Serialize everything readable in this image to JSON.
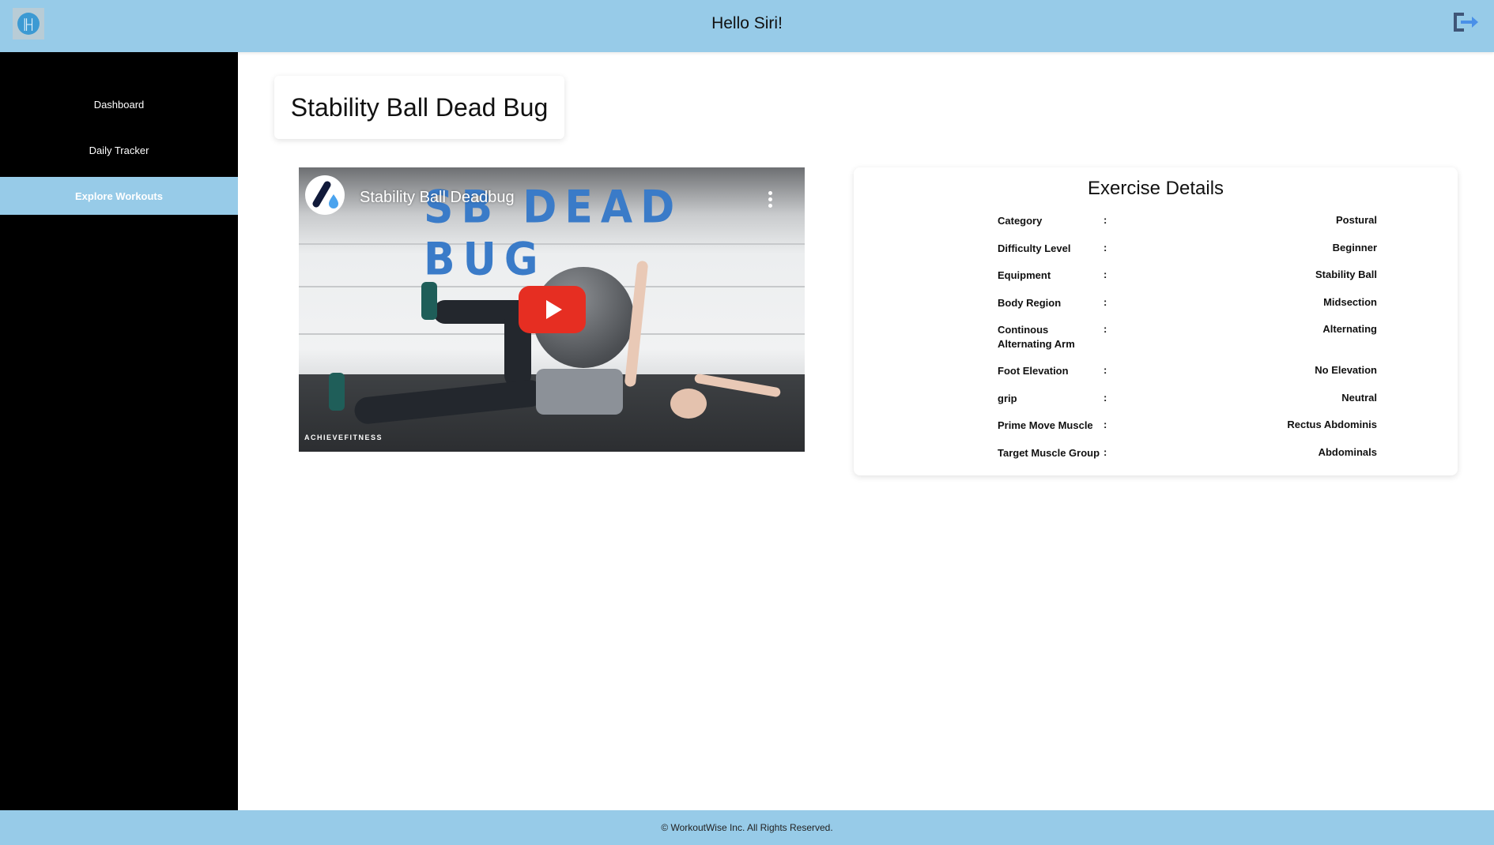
{
  "header": {
    "title": "Hello Siri!",
    "logo_icon": "dumbbell-icon",
    "logout_icon": "logout-icon"
  },
  "sidebar": {
    "items": [
      {
        "label": "Dashboard"
      },
      {
        "label": "Daily Tracker"
      },
      {
        "label": "Explore Workouts",
        "active": true
      }
    ]
  },
  "main": {
    "title": "Stability Ball Dead Bug",
    "video": {
      "title": "Stability Ball Deadbug",
      "overlay_text": "SB DEAD BUG",
      "watermark": "ACHIEVEFITNESS",
      "play_icon": "youtube-play-icon",
      "menu_icon": "more-vertical-icon"
    },
    "details": {
      "title": "Exercise Details",
      "separator": ":",
      "rows": [
        {
          "label": "Category",
          "value": "Postural"
        },
        {
          "label": "Difficulty Level",
          "value": "Beginner"
        },
        {
          "label": "Equipment",
          "value": "Stability Ball"
        },
        {
          "label": "Body Region",
          "value": "Midsection"
        },
        {
          "label": "Continous Alternating Arm",
          "value": "Alternating"
        },
        {
          "label": "Foot Elevation",
          "value": "No Elevation"
        },
        {
          "label": "grip",
          "value": "Neutral"
        },
        {
          "label": "Prime Move Muscle",
          "value": "Rectus Abdominis"
        },
        {
          "label": "Target Muscle Group",
          "value": "Abdominals"
        }
      ]
    }
  },
  "footer": {
    "text": "© WorkoutWise Inc. All Rights Reserved."
  },
  "colors": {
    "accent": "#97cbe8",
    "sidebar": "#000000",
    "play": "#e62e22"
  }
}
